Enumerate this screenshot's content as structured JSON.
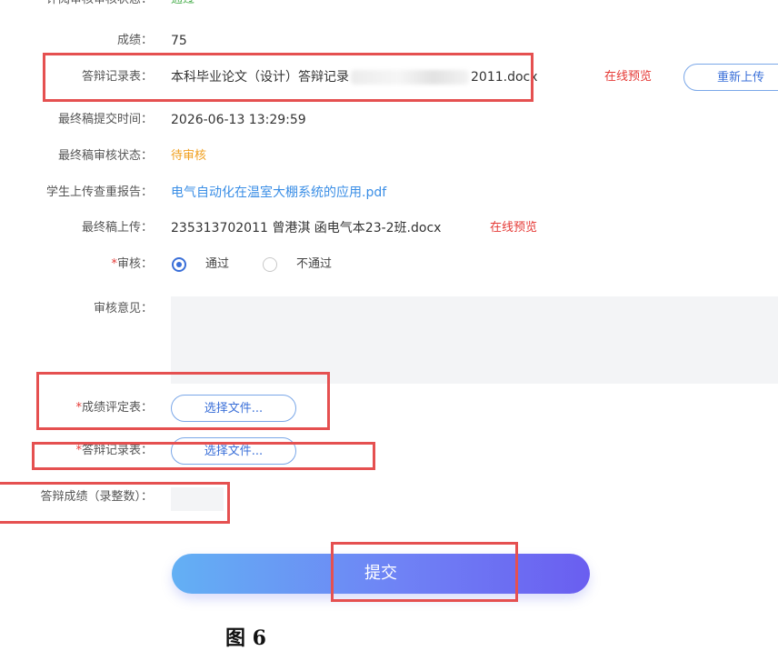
{
  "form": {
    "review_status": {
      "label": "评阅审核审核状态：",
      "value": "通过"
    },
    "score": {
      "label": "成绩：",
      "value": "75"
    },
    "defense_record": {
      "label": "答辩记录表：",
      "file_prefix": "本科毕业论文（设计）答辩记录",
      "file_suffix": "2011.docx",
      "preview": "在线预览",
      "reupload": "重新上传"
    },
    "final_submit_time": {
      "label": "最终稿提交时间：",
      "value": "2026-06-13 13:29:59"
    },
    "final_review_status": {
      "label": "最终稿审核状态：",
      "value": "待审核"
    },
    "plagiarism_report": {
      "label": "学生上传查重报告：",
      "value": "电气自动化在温室大棚系统的应用.pdf"
    },
    "final_upload": {
      "label": "最终稿上传：",
      "value": "235313702011 曾港淇 函电气本23-2班.docx",
      "preview": "在线预览"
    },
    "review": {
      "label": "审核：",
      "required": "*",
      "options": [
        "通过",
        "不通过"
      ],
      "selected": 0
    },
    "review_opinion": {
      "label": "审核意见："
    },
    "score_eval_form": {
      "label": "成绩评定表：",
      "required": "*",
      "button": "选择文件..."
    },
    "defense_record_upload": {
      "label": "答辩记录表：",
      "required": "*",
      "button": "选择文件..."
    },
    "defense_score": {
      "label": "答辩成绩（录整数）："
    },
    "submit": "提交"
  },
  "caption": "图 6",
  "colors": {
    "highlight": "#e55050",
    "link": "#3a8ee6",
    "danger": "#e53935",
    "pending": "#f0a020",
    "pass": "#4caf50",
    "accent": "#3a6fd8"
  }
}
